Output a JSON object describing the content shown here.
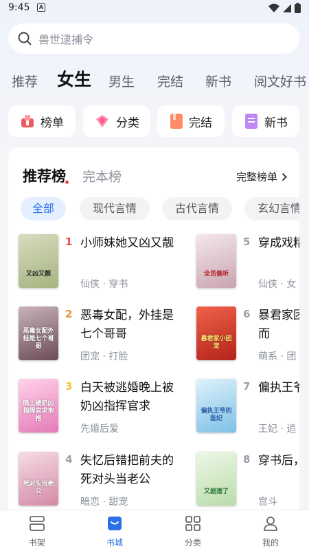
{
  "status_bar": {
    "time": "9:45",
    "notification_icon": "A"
  },
  "search": {
    "placeholder": "兽世逮捕令"
  },
  "top_tabs": [
    {
      "label": "推荐",
      "active": false
    },
    {
      "label": "女生",
      "active": true
    },
    {
      "label": "男生",
      "active": false
    },
    {
      "label": "完结",
      "active": false
    },
    {
      "label": "新书",
      "active": false
    },
    {
      "label": "阅文好书",
      "active": false
    }
  ],
  "quick_links": [
    {
      "label": "榜单",
      "icon": "ranking-icon",
      "color": "#ef5a5f"
    },
    {
      "label": "分类",
      "icon": "category-icon",
      "color": "#ff5c8a"
    },
    {
      "label": "完结",
      "icon": "finished-icon",
      "color": "#ff7d5a"
    },
    {
      "label": "新书",
      "icon": "new-book-icon",
      "color": "#b86cf0"
    }
  ],
  "ranking": {
    "tab_active": "推荐榜",
    "tab_other": "完本榜",
    "full_list_label": "完整榜单",
    "chips": [
      "全部",
      "现代言情",
      "古代言情",
      "玄幻言情"
    ],
    "books": [
      {
        "rank": "1",
        "title": "小师妹她又凶又靓",
        "tags": "仙侠 · 穿书",
        "cover_text": "又凶又靓",
        "cover_bg": "#b9c39a"
      },
      {
        "rank": "2",
        "title": "恶毒女配，外挂是七个哥哥",
        "tags": "团宠 · 打脸",
        "cover_text": "恶毒女配外挂是七个哥哥",
        "cover_bg": "#8f6e7a"
      },
      {
        "rank": "3",
        "title": "白天被逃婚晚上被奶凶指挥官求",
        "tags": "先婚后爱",
        "cover_text": "晚上被奶凶指挥官求抱抱",
        "cover_bg": "#f2a8d2"
      },
      {
        "rank": "4",
        "title": "失忆后错把前夫的死对头当老公",
        "tags": "暗恋 · 甜宠",
        "cover_text": "死对头当老公",
        "cover_bg": "#e9b7c8"
      },
      {
        "rank": "5",
        "title": "穿成戏精妹，全员",
        "tags": "仙侠 · 女",
        "cover_text": "全员偷听",
        "cover_bg": "#e8d3d8"
      },
      {
        "rank": "6",
        "title": "暴君家团宠她恃宠而",
        "tags": "萌系 · 团",
        "cover_text": "暴君家小团宠",
        "cover_bg": "#d8402c"
      },
      {
        "rank": "7",
        "title": "偏执王爷医妃",
        "tags": "王妃 · 追",
        "cover_text": "偏执王爷的医妃",
        "cover_bg": "#a9d8ef"
      },
      {
        "rank": "8",
        "title": "穿书后，妃又剧",
        "tags": "宫斗",
        "cover_text": "又剧透了",
        "cover_bg": "#d9ecd2"
      }
    ]
  },
  "bottom_nav": [
    {
      "label": "书架",
      "icon": "bookshelf-icon",
      "active": false
    },
    {
      "label": "书城",
      "icon": "bookstore-icon",
      "active": true
    },
    {
      "label": "分类",
      "icon": "grid-category-icon",
      "active": false
    },
    {
      "label": "我的",
      "icon": "profile-icon",
      "active": false
    }
  ],
  "colors": {
    "accent": "#2d6fe6",
    "rank_1": "#e84b47",
    "rank_2": "#f0903a",
    "rank_3": "#f3c33a",
    "rank_other": "#9aa0a8"
  }
}
